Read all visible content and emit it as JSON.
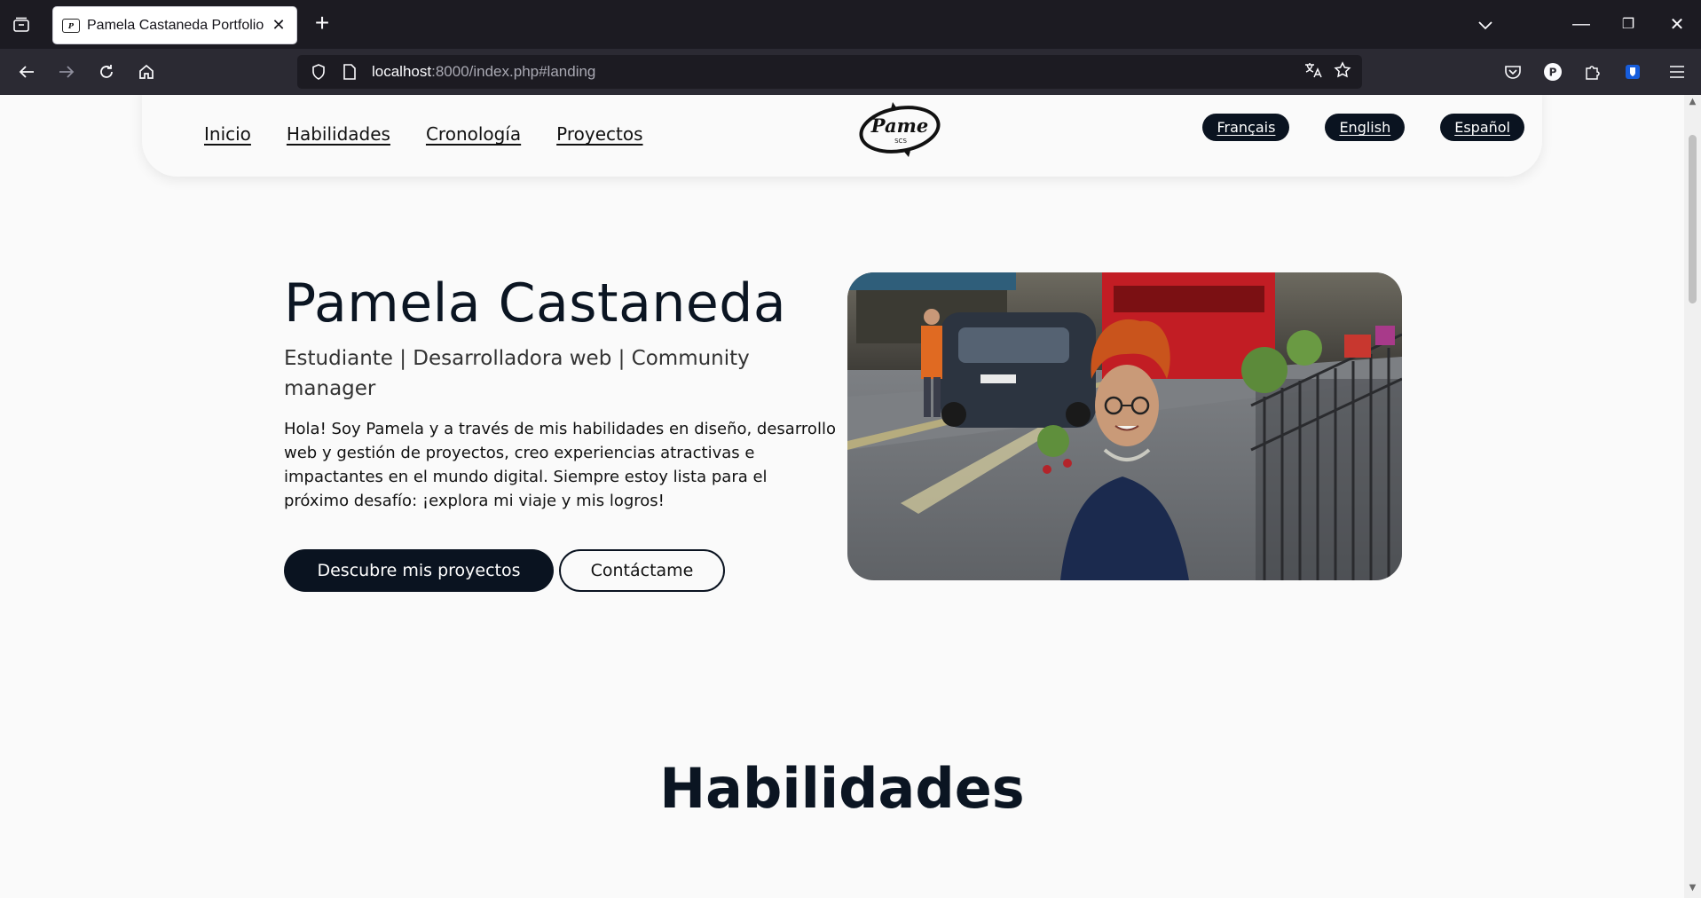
{
  "browser": {
    "tab_title": "Pamela Castaneda Portfolio",
    "tab_close": "✕",
    "new_tab": "+",
    "url_host": "localhost",
    "url_rest": ":8000/index.php#landing",
    "window": {
      "minimize": "—",
      "restore": "❐",
      "close": "✕"
    }
  },
  "site": {
    "menu": [
      "Inicio",
      "Habilidades",
      "Cronología",
      "Proyectos"
    ],
    "logo": {
      "text": "Pame",
      "subtext": "SCS"
    },
    "languages": [
      "Français",
      "English",
      "Español"
    ]
  },
  "hero": {
    "name": "Pamela Castaneda",
    "subtitle": "Estudiante | Desarrolladora web | Community manager",
    "description": "Hola! Soy Pamela y a través de mis habilidades en diseño, desarrollo web y gestión de proyectos, creo experiencias atractivas e impactantes en el mundo digital. Siempre estoy lista para el próximo desafío: ¡explora mi viaje y mis logros!",
    "primary_button": "Descubre mis proyectos",
    "secondary_button": "Contáctame"
  },
  "sections": {
    "skills_title": "Habilidades"
  },
  "colors": {
    "brand_dark": "#0a1320",
    "page_bg": "#fafafa",
    "chrome_dark": "#1c1b22",
    "chrome_mid": "#2b2a33"
  }
}
